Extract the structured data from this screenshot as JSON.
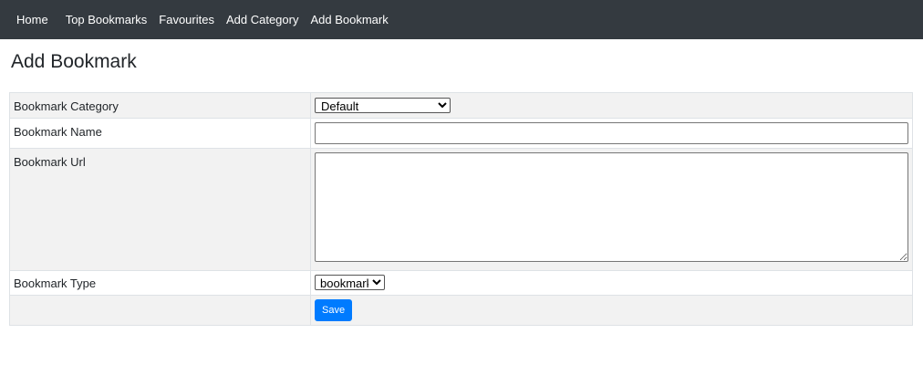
{
  "nav": {
    "home": "Home",
    "top_bookmarks": "Top Bookmarks",
    "favourites": "Favourites",
    "add_category": "Add Category",
    "add_bookmark": "Add Bookmark"
  },
  "page": {
    "title": "Add Bookmark"
  },
  "form": {
    "category_label": "Bookmark Category",
    "category_selected": "Default",
    "name_label": "Bookmark Name",
    "name_value": "",
    "url_label": "Bookmark Url",
    "url_value": "",
    "type_label": "Bookmark Type",
    "type_selected": "bookmark",
    "save_label": "Save"
  },
  "colors": {
    "navbar_bg": "#343a40",
    "primary": "#007bff",
    "row_stripe": "#f2f2f2"
  }
}
